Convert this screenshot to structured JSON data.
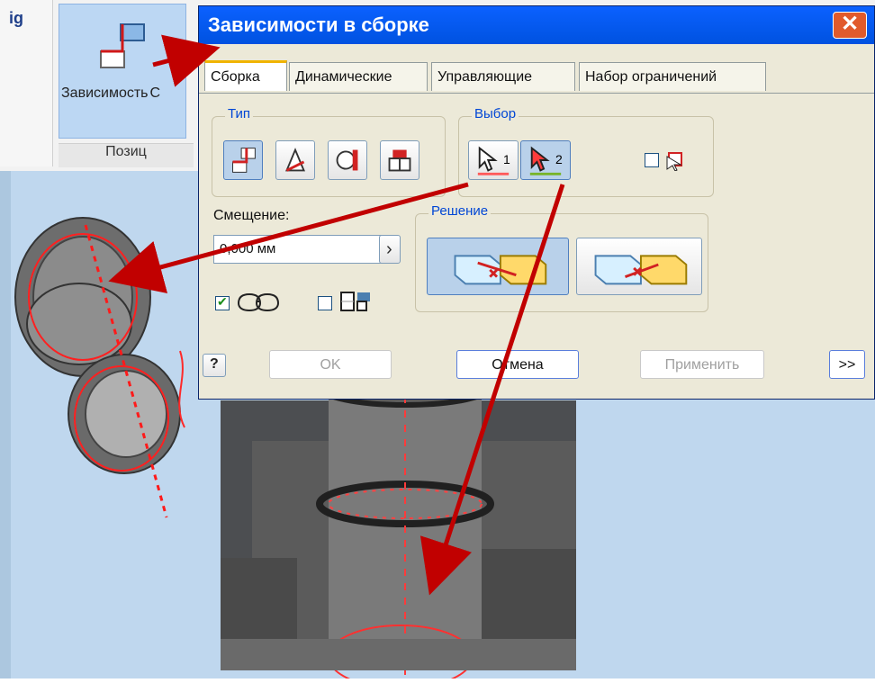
{
  "ribbon": {
    "tiny_icon": "ig",
    "constraint_button": {
      "label": "Зависимость",
      "label_overflow": "С"
    },
    "panel_title": "Позиц"
  },
  "dialog": {
    "title": "Зависимости в сборке",
    "close_label": "✕",
    "tabs": [
      {
        "label": "Сборка",
        "active": true
      },
      {
        "label": "Динамические"
      },
      {
        "label": "Управляющие"
      },
      {
        "label": "Набор ограничений"
      }
    ],
    "type_group": {
      "title": "Тип"
    },
    "selection_group": {
      "title": "Выбор",
      "select1_text": "1",
      "select2_text": "2"
    },
    "offset": {
      "label": "Смещение:",
      "value": "0,000 мм",
      "arrow": "›"
    },
    "solution_group": {
      "title": "Решение"
    },
    "options": {
      "preview_checked": true,
      "predict_offset_checked": false
    },
    "footer": {
      "help": "?",
      "ok": "OK",
      "cancel": "Отмена",
      "apply": "Применить",
      "more": ">>"
    }
  },
  "colors": {
    "viewport_bg": "#bfd7ee",
    "arrow": "#c10000",
    "dialog_bg": "#ece9d8",
    "title_blue": "#0052e0"
  }
}
